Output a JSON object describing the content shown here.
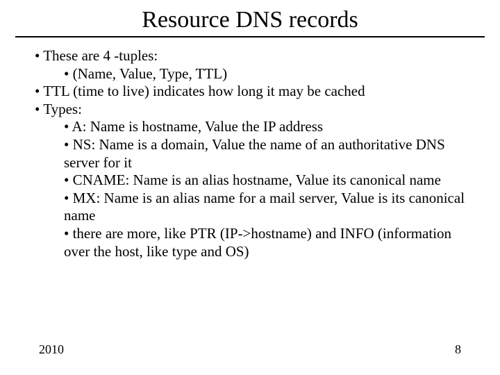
{
  "title": "Resource DNS records",
  "bullets": {
    "b1": "• These are 4 -tuples:",
    "b1a": "• (Name, Value, Type, TTL)",
    "b2": "• TTL (time to live) indicates how long it may be cached",
    "b3": "• Types:",
    "b3a": "• A: Name is hostname, Value the IP address",
    "b3b": "• NS: Name is a domain, Value the name of an authoritative DNS server for it",
    "b3c": "• CNAME: Name is an alias hostname, Value its canonical name",
    "b3d": "• MX: Name is an alias name for a mail server, Value is its canonical name",
    "b3e": "• there are more, like PTR (IP->hostname) and INFO (information over the host, like type and OS)"
  },
  "footer": {
    "year": "2010",
    "page": "8"
  }
}
